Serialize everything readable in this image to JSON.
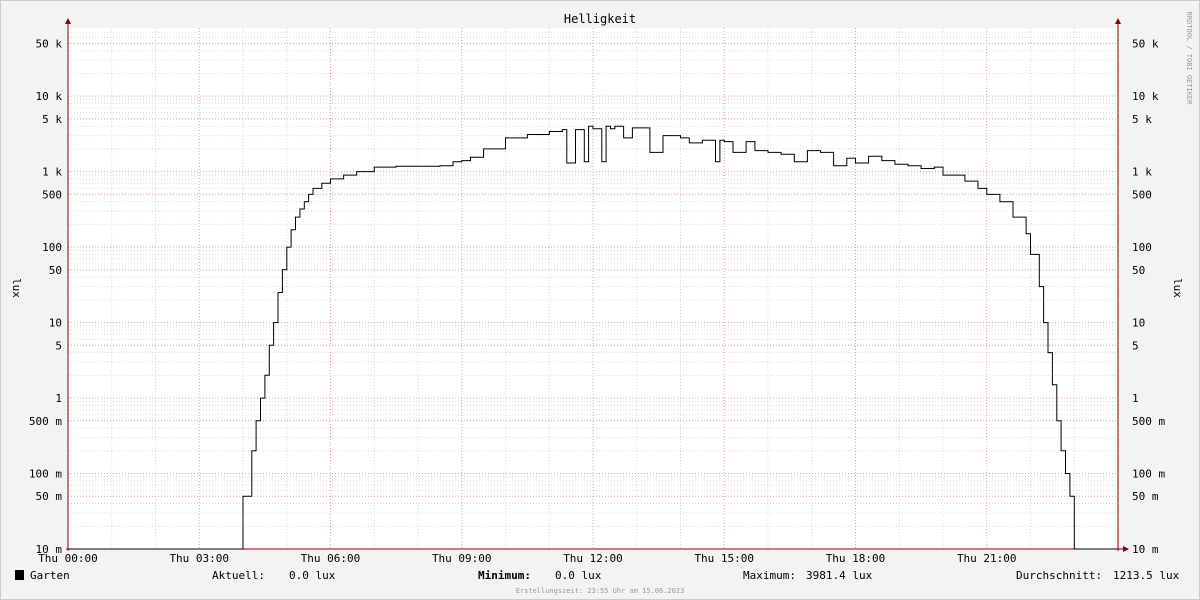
{
  "chart_data": {
    "type": "line",
    "title": "Helligkeit",
    "ylabel": "lux",
    "y_scale": "log",
    "ylim": [
      0.01,
      80000
    ],
    "y_ticks": [
      {
        "value": 0.01,
        "label": "10 m"
      },
      {
        "value": 0.05,
        "label": "50 m"
      },
      {
        "value": 0.1,
        "label": "100 m"
      },
      {
        "value": 0.5,
        "label": "500 m"
      },
      {
        "value": 1,
        "label": "1"
      },
      {
        "value": 5,
        "label": "5"
      },
      {
        "value": 10,
        "label": "10"
      },
      {
        "value": 50,
        "label": "50"
      },
      {
        "value": 100,
        "label": "100"
      },
      {
        "value": 500,
        "label": "500"
      },
      {
        "value": 1000,
        "label": "1 k"
      },
      {
        "value": 5000,
        "label": "5 k"
      },
      {
        "value": 10000,
        "label": "10 k"
      },
      {
        "value": 50000,
        "label": "50 k"
      }
    ],
    "x_unit": "hours",
    "xlim": [
      0,
      24
    ],
    "x_ticks": [
      {
        "value": 0,
        "label": "Thu 00:00"
      },
      {
        "value": 3,
        "label": "Thu 03:00"
      },
      {
        "value": 6,
        "label": "Thu 06:00"
      },
      {
        "value": 9,
        "label": "Thu 09:00"
      },
      {
        "value": 12,
        "label": "Thu 12:00"
      },
      {
        "value": 15,
        "label": "Thu 15:00"
      },
      {
        "value": 18,
        "label": "Thu 18:00"
      },
      {
        "value": 21,
        "label": "Thu 21:00"
      }
    ],
    "grid": true,
    "series": [
      {
        "name": "Garten",
        "color": "#000000",
        "x": [
          0,
          4.0,
          4.0,
          4.2,
          4.3,
          4.4,
          4.5,
          4.6,
          4.7,
          4.8,
          4.9,
          5.0,
          5.1,
          5.2,
          5.3,
          5.4,
          5.5,
          5.6,
          5.8,
          6.0,
          6.3,
          6.6,
          7.0,
          7.5,
          8.0,
          8.5,
          8.8,
          9.0,
          9.2,
          9.5,
          10.0,
          10.5,
          11.0,
          11.3,
          11.4,
          11.6,
          11.8,
          11.9,
          12.0,
          12.2,
          12.3,
          12.4,
          12.5,
          12.7,
          12.9,
          13.0,
          13.3,
          13.6,
          14.0,
          14.2,
          14.5,
          14.8,
          14.9,
          15.0,
          15.2,
          15.5,
          15.7,
          16.0,
          16.3,
          16.6,
          16.9,
          17.2,
          17.5,
          17.8,
          18.0,
          18.3,
          18.6,
          18.9,
          19.2,
          19.5,
          19.8,
          20.0,
          20.5,
          20.8,
          21.0,
          21.3,
          21.6,
          21.9,
          22.0,
          22.2,
          22.3,
          22.4,
          22.5,
          22.6,
          22.7,
          22.8,
          22.9,
          23.0,
          23.1,
          23.2,
          23.4,
          23.4,
          24.0
        ],
        "y": [
          0.01,
          0.01,
          0.05,
          0.2,
          0.5,
          1,
          2,
          5,
          10,
          25,
          50,
          100,
          170,
          250,
          320,
          400,
          500,
          600,
          700,
          800,
          900,
          1000,
          1150,
          1180,
          1180,
          1200,
          1350,
          1400,
          1550,
          2000,
          2800,
          3100,
          3400,
          3600,
          1300,
          3600,
          1350,
          4000,
          3700,
          1350,
          4000,
          3700,
          4000,
          2800,
          3800,
          3800,
          1800,
          3000,
          2800,
          2400,
          2600,
          1350,
          2600,
          2500,
          1800,
          2500,
          1900,
          1800,
          1700,
          1350,
          1900,
          1800,
          1200,
          1500,
          1300,
          1600,
          1400,
          1250,
          1200,
          1100,
          1150,
          900,
          750,
          600,
          500,
          400,
          250,
          150,
          80,
          30,
          10,
          4,
          1.5,
          0.5,
          0.2,
          0.1,
          0.05,
          0.01,
          0.01,
          0.01,
          0.01,
          0.01,
          0.01
        ]
      }
    ]
  },
  "legend": {
    "series_name": "Garten",
    "swatch_color": "#000000",
    "current_label": "Aktuell:",
    "current_value": "0.0 lux",
    "min_label": "Minimum:",
    "min_value": "0.0 lux",
    "max_label": "Maximum:",
    "max_value": "3981.4 lux",
    "avg_label": "Durchschnitt:",
    "avg_value": "1213.5 lux"
  },
  "footer": "Erstellungszeit: 23:55 Uhr am 15.06.2023",
  "watermark": "RRDTOOL / TOBI OETIKER",
  "colors": {
    "background": "#f3f3f3",
    "plot_background": "#ffffff",
    "major_grid": "#e89aa4",
    "minor_grid": "#d9d9d9",
    "axis": "#8b0000",
    "line": "#000000"
  }
}
